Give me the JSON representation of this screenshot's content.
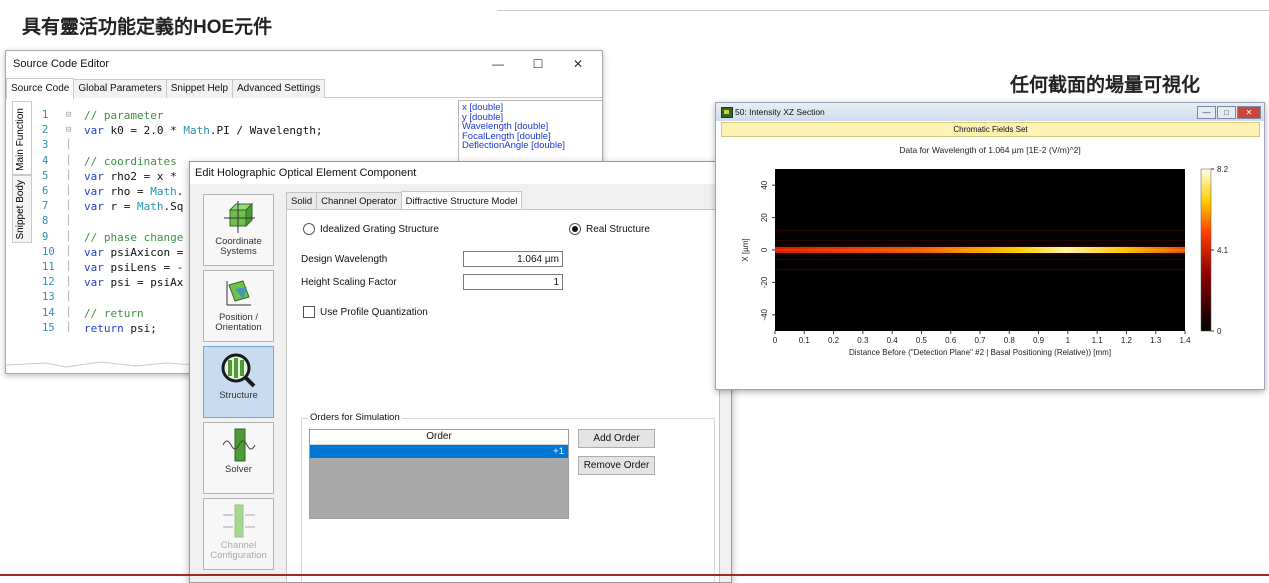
{
  "slide": {
    "title": "具有靈活功能定義的HOE元件",
    "right_caption": "任何截面的場量可視化"
  },
  "source_editor": {
    "title": "Source Code Editor",
    "controls": {
      "minimize": "—",
      "maximize": "☐",
      "close": "✕"
    },
    "tabs": [
      "Source Code",
      "Global Parameters",
      "Snippet Help",
      "Advanced Settings"
    ],
    "side_tabs": [
      "Main Function",
      "Snippet Body"
    ],
    "line_numbers": [
      "1",
      "2",
      "3",
      "4",
      "5",
      "6",
      "7",
      "8",
      "9",
      "10",
      "11",
      "12",
      "13",
      "14",
      "15"
    ],
    "code_lines": [
      [
        {
          "t": "// parameter",
          "c": "comment"
        }
      ],
      [
        {
          "t": "var",
          "c": "kw"
        },
        {
          "t": " k0 = 2.0 * ",
          "c": "plain"
        },
        {
          "t": "Math",
          "c": "cls"
        },
        {
          "t": ".PI / Wavelength;",
          "c": "plain"
        }
      ],
      [],
      [
        {
          "t": "// coordinates",
          "c": "comment"
        }
      ],
      [
        {
          "t": "var",
          "c": "kw"
        },
        {
          "t": " rho2 = x * ",
          "c": "plain"
        }
      ],
      [
        {
          "t": "var",
          "c": "kw"
        },
        {
          "t": " rho = ",
          "c": "plain"
        },
        {
          "t": "Math",
          "c": "cls"
        },
        {
          "t": ".",
          "c": "plain"
        }
      ],
      [
        {
          "t": "var",
          "c": "kw"
        },
        {
          "t": " r = ",
          "c": "plain"
        },
        {
          "t": "Math",
          "c": "cls"
        },
        {
          "t": ".Sq",
          "c": "plain"
        }
      ],
      [],
      [
        {
          "t": "// phase change",
          "c": "comment"
        }
      ],
      [
        {
          "t": "var",
          "c": "kw"
        },
        {
          "t": " psiAxicon =",
          "c": "plain"
        }
      ],
      [
        {
          "t": "var",
          "c": "kw"
        },
        {
          "t": " psiLens = -",
          "c": "plain"
        }
      ],
      [
        {
          "t": "var",
          "c": "kw"
        },
        {
          "t": " psi = psiAx",
          "c": "plain"
        }
      ],
      [],
      [
        {
          "t": "// return",
          "c": "comment"
        }
      ],
      [
        {
          "t": "return",
          "c": "kw"
        },
        {
          "t": " psi;",
          "c": "plain"
        }
      ]
    ],
    "variables": [
      "x [double]",
      "y [double]",
      "Wavelength [double]",
      "FocalLength [double]",
      "DeflectionAngle [double]"
    ]
  },
  "hoe_dialog": {
    "title": "Edit Holographic Optical Element Component",
    "side_buttons": [
      {
        "label": "Coordinate Systems",
        "icon": "coordinate-systems-icon"
      },
      {
        "label": "Position / Orientation",
        "icon": "position-orientation-icon"
      },
      {
        "label": "Structure",
        "icon": "structure-icon"
      },
      {
        "label": "Solver",
        "icon": "solver-icon"
      },
      {
        "label": "Channel Configuration",
        "icon": "channel-configuration-icon"
      }
    ],
    "tabs": [
      "Solid",
      "Channel Operator",
      "Diffractive Structure Model"
    ],
    "radio_idealized": "Idealized Grating Structure",
    "radio_real": "Real Structure",
    "design_wavelength_label": "Design Wavelength",
    "design_wavelength_value": "1.064 µm",
    "height_scaling_label": "Height Scaling Factor",
    "height_scaling_value": "1",
    "use_profile_quantization": "Use Profile Quantization",
    "orders_group": "Orders for Simulation",
    "order_header": "Order",
    "orders": [
      "+1"
    ],
    "add_order": "Add Order",
    "remove_order": "Remove Order"
  },
  "intensity_window": {
    "title": "50: Intensity XZ Section",
    "banner": "Chromatic Fields Set",
    "controls": {
      "minimize": "—",
      "maximize": "□",
      "close": "✕"
    },
    "colors": {
      "accent_blue": "#0078d7"
    }
  },
  "chart_data": {
    "type": "heatmap",
    "title": "Data for Wavelength of 1.064 µm  [1E-2 (V/m)^2]",
    "xlabel": "Distance Before (\"Detection Plane\" #2 | Basal Positioning (Relative)) [mm]",
    "ylabel": "X [µm]",
    "x_ticks": [
      "0",
      "0.1",
      "0.2",
      "0.3",
      "0.4",
      "0.5",
      "0.6",
      "0.7",
      "0.8",
      "0.9",
      "1",
      "1.1",
      "1.2",
      "1.3",
      "1.4"
    ],
    "y_ticks": [
      "40",
      "20",
      "0",
      "-20",
      "-40"
    ],
    "xlim": [
      0,
      1.4
    ],
    "ylim": [
      -50,
      50
    ],
    "colorbar_ticks": [
      "8.2",
      "4.1",
      "0"
    ],
    "colorbar_range": [
      0,
      8.2
    ],
    "colormap": "black-red-yellow-white",
    "peak_value": 8.2,
    "peak_x": 1.0
  }
}
